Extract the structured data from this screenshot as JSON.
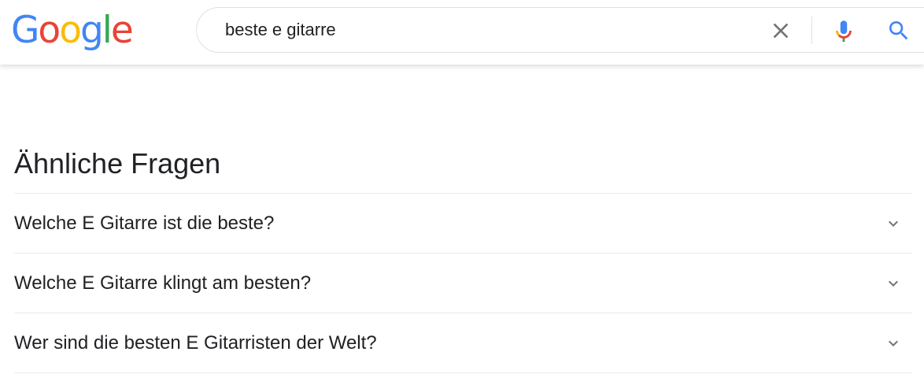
{
  "header": {
    "logo": {
      "letters": [
        "G",
        "o",
        "o",
        "g",
        "l",
        "e"
      ],
      "colors": [
        "#4285F4",
        "#EA4335",
        "#FBBC05",
        "#4285F4",
        "#34A853",
        "#EA4335"
      ]
    },
    "search": {
      "value": "beste e gitarre",
      "clear_icon": "close-icon",
      "voice_icon": "microphone-icon",
      "search_icon": "search-icon",
      "search_icon_color": "#4285F4"
    }
  },
  "related_questions": {
    "title": "Ähnliche Fragen",
    "items": [
      {
        "question": "Welche E Gitarre ist die beste?",
        "icon": "chevron-down-icon"
      },
      {
        "question": "Welche E Gitarre klingt am besten?",
        "icon": "chevron-down-icon"
      },
      {
        "question": "Wer sind die besten E Gitarristen der Welt?",
        "icon": "chevron-down-icon"
      }
    ]
  }
}
